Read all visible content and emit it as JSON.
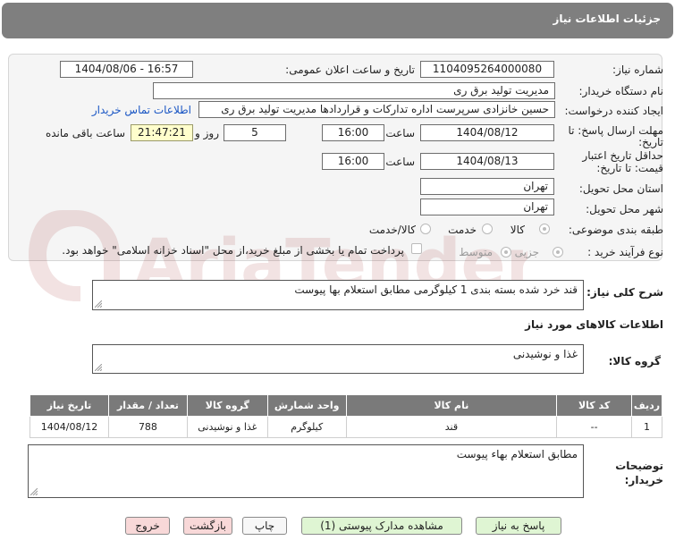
{
  "header": {
    "title": "جزئیات اطلاعات نیاز"
  },
  "fields": {
    "need_number": {
      "label": "شماره نیاز:",
      "value": "1104095264000080"
    },
    "announce_datetime": {
      "label": "تاریخ و ساعت اعلان عمومی:",
      "value": "1404/08/06 - 16:57"
    },
    "buyer_org": {
      "label": "نام دستگاه خریدار:",
      "value": "مدیریت تولید برق ری"
    },
    "requester": {
      "label": "ایجاد کننده درخواست:",
      "value": "حسین خانزادی سرپرست اداره تدارکات و قراردادها مدیریت تولید برق ری"
    },
    "contact_link": "اطلاعات تماس خریدار",
    "reply_deadline": {
      "label_line1": "مهلت ارسال پاسخ: تا",
      "label_line2": "تاریخ:",
      "date": "1404/08/12",
      "time_label": "ساعت",
      "time": "16:00",
      "days": "5",
      "days_label": "روز و",
      "remaining": "21:47:21",
      "remaining_label": "ساعت باقی مانده"
    },
    "validity": {
      "label_line1": "حداقل تاریخ اعتبار",
      "label_line2": "قیمت: تا تاریخ:",
      "date": "1404/08/13",
      "time_label": "ساعت",
      "time": "16:00"
    },
    "province": {
      "label": "استان محل تحویل:",
      "value": "تهران"
    },
    "city": {
      "label": "شهر محل تحویل:",
      "value": "تهران"
    },
    "category": {
      "label": "طبقه بندی موضوعی:",
      "options": [
        "کالا",
        "خدمت",
        "کالا/خدمت"
      ],
      "selected": "کالا"
    },
    "process_type": {
      "label": "نوع فرآیند خرید :",
      "options": [
        "جزیی",
        "متوسط"
      ],
      "selected": "جزیی",
      "payment_note": "پرداخت تمام یا بخشی از مبلغ خرید،از محل \"اسناد خزانه اسلامی\" خواهد بود."
    }
  },
  "description": {
    "label": "شرح کلی نیاز:",
    "value": "قند خرد شده بسته بندی 1 کیلوگرمی مطابق استعلام بها پیوست"
  },
  "goods_section": {
    "title": "اطلاعات کالاهای مورد نیاز",
    "group_label": "گروه کالا:",
    "group_value": "غذا و نوشیدنی"
  },
  "table": {
    "headers": [
      "ردیف",
      "کد کالا",
      "نام کالا",
      "واحد شمارش",
      "گروه کالا",
      "تعداد / مقدار",
      "تاریخ نیاز"
    ],
    "rows": [
      [
        "1",
        "--",
        "قند",
        "کیلوگرم",
        "غذا و نوشیدنی",
        "788",
        "1404/08/12"
      ]
    ]
  },
  "buyer_notes": {
    "label_line1": "توضیحات",
    "label_line2": "خریدار:",
    "value": "مطابق استعلام بهاء پیوست"
  },
  "buttons": {
    "reply": "پاسخ به نیاز",
    "attachments": "مشاهده مدارک پیوستی (1)",
    "print": "چاپ",
    "back": "بازگشت",
    "exit": "خروج"
  },
  "watermark": {
    "text": "AriaTender.neT"
  }
}
